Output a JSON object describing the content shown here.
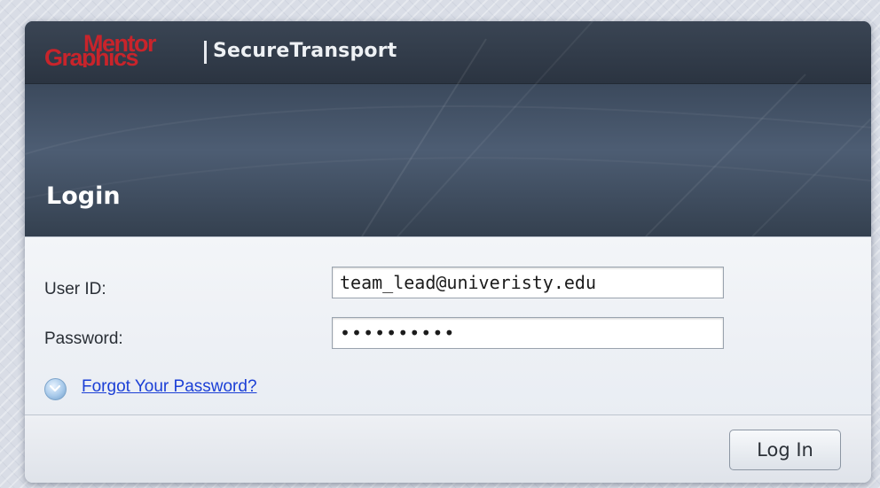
{
  "brand": {
    "logo_line1": "Mentor",
    "logo_line2": "Graphics",
    "product_name": "SecureTransport",
    "logo_color": "#c8242b"
  },
  "page": {
    "title": "Login"
  },
  "form": {
    "user_id_label": "User ID:",
    "user_id_value": "team_lead@univeristy.edu",
    "password_label": "Password:",
    "password_value": "••••••••••",
    "forgot_link": "Forgot Your Password?",
    "forgot_icon": "chevron-down-icon"
  },
  "footer": {
    "login_button": "Log In"
  },
  "colors": {
    "header_dark": "#2c3645",
    "link": "#1b3fd6",
    "panel": "#eef1f6"
  }
}
